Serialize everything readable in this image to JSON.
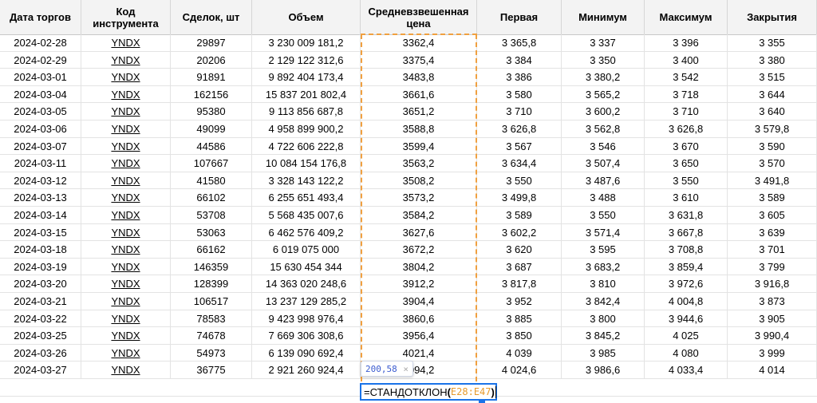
{
  "columns": [
    "Дата торгов",
    "Код\nинструмента",
    "Сделок, шт",
    "Объем",
    "Средневзвешенная\nцена",
    "Первая",
    "Минимум",
    "Максимум",
    "Закрытия"
  ],
  "rows": [
    [
      "2024-02-28",
      "YNDX",
      "29897",
      "3 230 009 181,2",
      "3362,4",
      "3 365,8",
      "3 337",
      "3 396",
      "3 355"
    ],
    [
      "2024-02-29",
      "YNDX",
      "20206",
      "2 129 122 312,6",
      "3375,4",
      "3 384",
      "3 350",
      "3 400",
      "3 380"
    ],
    [
      "2024-03-01",
      "YNDX",
      "91891",
      "9 892 404 173,4",
      "3483,8",
      "3 386",
      "3 380,2",
      "3 542",
      "3 515"
    ],
    [
      "2024-03-04",
      "YNDX",
      "162156",
      "15 837 201 802,4",
      "3661,6",
      "3 580",
      "3 565,2",
      "3 718",
      "3 644"
    ],
    [
      "2024-03-05",
      "YNDX",
      "95380",
      "9 113 856 687,8",
      "3651,2",
      "3 710",
      "3 600,2",
      "3 710",
      "3 640"
    ],
    [
      "2024-03-06",
      "YNDX",
      "49099",
      "4 958 899 900,2",
      "3588,8",
      "3 626,8",
      "3 562,8",
      "3 626,8",
      "3 579,8"
    ],
    [
      "2024-03-07",
      "YNDX",
      "44586",
      "4 722 606 222,8",
      "3599,4",
      "3 567",
      "3 546",
      "3 670",
      "3 590"
    ],
    [
      "2024-03-11",
      "YNDX",
      "107667",
      "10 084 154 176,8",
      "3563,2",
      "3 634,4",
      "3 507,4",
      "3 650",
      "3 570"
    ],
    [
      "2024-03-12",
      "YNDX",
      "41580",
      "3 328 143 122,2",
      "3508,2",
      "3 550",
      "3 487,6",
      "3 550",
      "3 491,8"
    ],
    [
      "2024-03-13",
      "YNDX",
      "66102",
      "6 255 651 493,4",
      "3573,2",
      "3 499,8",
      "3 488",
      "3 610",
      "3 589"
    ],
    [
      "2024-03-14",
      "YNDX",
      "53708",
      "5 568 435 007,6",
      "3584,2",
      "3 589",
      "3 550",
      "3 631,8",
      "3 605"
    ],
    [
      "2024-03-15",
      "YNDX",
      "53063",
      "6 462 576 409,2",
      "3627,6",
      "3 602,2",
      "3 571,4",
      "3 667,8",
      "3 639"
    ],
    [
      "2024-03-18",
      "YNDX",
      "66162",
      "6 019 075 000",
      "3672,2",
      "3 620",
      "3 595",
      "3 708,8",
      "3 701"
    ],
    [
      "2024-03-19",
      "YNDX",
      "146359",
      "15 630 454 344",
      "3804,2",
      "3 687",
      "3 683,2",
      "3 859,4",
      "3 799"
    ],
    [
      "2024-03-20",
      "YNDX",
      "128399",
      "14 363 020 248,6",
      "3912,2",
      "3 817,8",
      "3 810",
      "3 972,6",
      "3 916,8"
    ],
    [
      "2024-03-21",
      "YNDX",
      "106517",
      "13 237 129 285,2",
      "3904,4",
      "3 952",
      "3 842,4",
      "4 004,8",
      "3 873"
    ],
    [
      "2024-03-22",
      "YNDX",
      "78583",
      "9 423 998 976,4",
      "3860,6",
      "3 885",
      "3 800",
      "3 944,6",
      "3 905"
    ],
    [
      "2024-03-25",
      "YNDX",
      "74678",
      "7 669 306 308,6",
      "3956,4",
      "3 850",
      "3 845,2",
      "4 025",
      "3 990,4"
    ],
    [
      "2024-03-26",
      "YNDX",
      "54973",
      "6 139 090 692,4",
      "4021,4",
      "4 039",
      "3 985",
      "4 080",
      "3 999"
    ],
    [
      "2024-03-27",
      "YNDX",
      "36775",
      "2 921 260 924,4",
      "4094,2",
      "4 024,6",
      "3 986,6",
      "4 033,4",
      "4 014"
    ]
  ],
  "tooltip": {
    "value": "200,58",
    "close": "×"
  },
  "formula": {
    "fn": "=СТАНДОТКЛОН",
    "open": "(",
    "range": "E28:E47",
    "close": ")"
  },
  "colors": {
    "selection": "#f0a040",
    "active_border": "#1a73e8",
    "range_ref": "#e69a2c"
  }
}
